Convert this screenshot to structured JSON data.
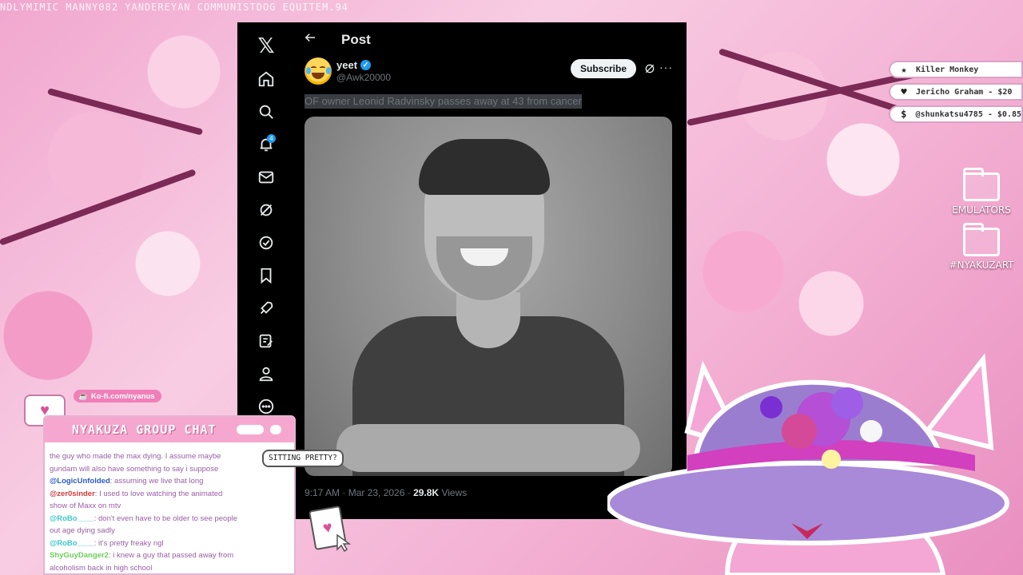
{
  "ticker": {
    "text": "NDLYMIMIC   MANNY082   YANDEREYAN   COMMUNISTDOG   EQUITEM.94"
  },
  "x_window": {
    "nav": {
      "logo": "𝕏",
      "items": [
        {
          "name": "home",
          "icon": "home-icon"
        },
        {
          "name": "explore",
          "icon": "search-icon"
        },
        {
          "name": "notifications",
          "icon": "bell-icon",
          "badge": "4"
        },
        {
          "name": "messages",
          "icon": "mail-icon"
        },
        {
          "name": "grok",
          "icon": "grok-icon"
        },
        {
          "name": "premium",
          "icon": "verified-check-icon"
        },
        {
          "name": "bookmarks",
          "icon": "bookmark-icon"
        },
        {
          "name": "jobs",
          "icon": "rocket-icon"
        },
        {
          "name": "post",
          "icon": "compose-icon"
        },
        {
          "name": "profile",
          "icon": "person-icon"
        },
        {
          "name": "more",
          "icon": "more-circle-icon"
        }
      ]
    },
    "header": {
      "title": "Post"
    },
    "post": {
      "display_name": "yeet",
      "handle": "@Awk20000",
      "subscribe_label": "Subscribe",
      "text": "OF owner Leonid Radvinsky passes away at 43 from cancer",
      "time": "9:17 AM · Mar 23, 2026 · ",
      "views_count": "29.8K",
      "views_label": " Views"
    },
    "accent": "#1d9bf0"
  },
  "alerts": [
    {
      "icon": "★",
      "text": "Killer Monkey"
    },
    {
      "icon": "♥",
      "text": "Jericho Graham - $20"
    },
    {
      "icon": "$",
      "text": "@shunkatsu4785 - $0.85"
    }
  ],
  "desktop_icons": [
    {
      "label": "EMULATORS"
    },
    {
      "label": "#NYAKUZART"
    }
  ],
  "chat": {
    "kofi": "Ko-fi.com/nyanus",
    "title": "NYAKUZA GROUP CHAT",
    "sitting": "SITTING PRETTY?",
    "lines": [
      {
        "user": "",
        "msg": "the guy who made the max dying. I assume maybe"
      },
      {
        "user": "",
        "msg": "gundam will also have something to say i suppose"
      },
      {
        "user": "@LogicUnfolded",
        "msg": ": assuming we live that long",
        "color": "#2b59c3"
      },
      {
        "user": "@zer0sinder",
        "msg": ": I used to love watching the animated",
        "color": "#d23a3a"
      },
      {
        "user": "",
        "msg": "show of Maxx on mtv"
      },
      {
        "user": "@RoBo____",
        "msg": ": don't even have to be older to see people",
        "color": "#3fc7c7"
      },
      {
        "user": "",
        "msg": "out age dying sadly"
      },
      {
        "user": "@RoBo____",
        "msg": ": it's pretty freaky ngl",
        "color": "#3fc7c7"
      },
      {
        "user": "ShyGuyDanger2",
        "msg": ": i knew a guy that passed away from",
        "color": "#6bcf5a"
      },
      {
        "user": "",
        "msg": "alcoholism back in high school"
      }
    ]
  }
}
